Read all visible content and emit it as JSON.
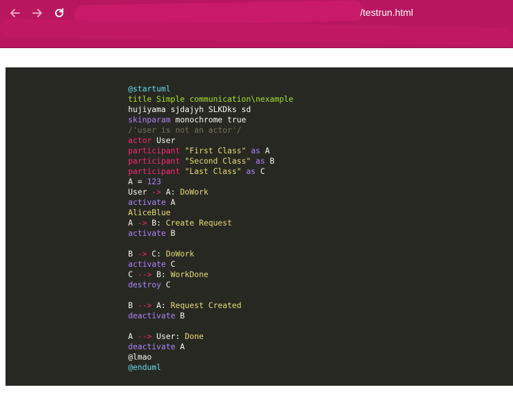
{
  "browser": {
    "url_visible": "/testrun.html",
    "back_icon": "arrow-left-icon",
    "forward_icon": "arrow-right-icon",
    "reload_icon": "reload-icon",
    "accent": "#b8175f"
  },
  "code_panel": {
    "background": "#272822",
    "lines": [
      [
        {
          "t": "@startuml",
          "c": "teal"
        }
      ],
      [
        {
          "t": "title Simple communication\\nexample",
          "c": "grn"
        }
      ],
      [
        {
          "t": "hujiyama sjdajyh SLKDks sd",
          "c": ""
        }
      ],
      [
        {
          "t": "skinparam",
          "c": "kw2"
        },
        {
          "t": " monochrome true",
          "c": ""
        }
      ],
      [
        {
          "t": "/'user is not an actor'/",
          "c": "cm"
        }
      ],
      [
        {
          "t": "actor",
          "c": "kw"
        },
        {
          "t": " User",
          "c": ""
        }
      ],
      [
        {
          "t": "participant",
          "c": "kw"
        },
        {
          "t": " ",
          "c": ""
        },
        {
          "t": "\"First Class\"",
          "c": "str"
        },
        {
          "t": " ",
          "c": ""
        },
        {
          "t": "as",
          "c": "kw2"
        },
        {
          "t": " A",
          "c": ""
        }
      ],
      [
        {
          "t": "participant",
          "c": "kw"
        },
        {
          "t": " ",
          "c": ""
        },
        {
          "t": "\"Second Class\"",
          "c": "str"
        },
        {
          "t": " ",
          "c": ""
        },
        {
          "t": "as",
          "c": "kw2"
        },
        {
          "t": " B",
          "c": ""
        }
      ],
      [
        {
          "t": "participant",
          "c": "kw"
        },
        {
          "t": " ",
          "c": ""
        },
        {
          "t": "\"Last Class\"",
          "c": "str"
        },
        {
          "t": " ",
          "c": ""
        },
        {
          "t": "as",
          "c": "kw2"
        },
        {
          "t": " C",
          "c": ""
        }
      ],
      [
        {
          "t": "A = ",
          "c": ""
        },
        {
          "t": "123",
          "c": "kw2"
        }
      ],
      [
        {
          "t": "User ",
          "c": ""
        },
        {
          "t": "->",
          "c": "kw"
        },
        {
          "t": " A: ",
          "c": ""
        },
        {
          "t": "DoWork",
          "c": "str"
        }
      ],
      [
        {
          "t": "activate",
          "c": "kw2"
        },
        {
          "t": " A",
          "c": ""
        }
      ],
      [
        {
          "t": "AliceBlue",
          "c": "str"
        }
      ],
      [
        {
          "t": "A ",
          "c": ""
        },
        {
          "t": "->",
          "c": "kw"
        },
        {
          "t": " B: ",
          "c": ""
        },
        {
          "t": "Create Request",
          "c": "str"
        }
      ],
      [
        {
          "t": "activate",
          "c": "kw2"
        },
        {
          "t": " B",
          "c": ""
        }
      ],
      [
        {
          "t": "",
          "c": ""
        }
      ],
      [
        {
          "t": "B ",
          "c": ""
        },
        {
          "t": "->",
          "c": "kw"
        },
        {
          "t": " C: ",
          "c": ""
        },
        {
          "t": "DoWork",
          "c": "str"
        }
      ],
      [
        {
          "t": "activate",
          "c": "kw2"
        },
        {
          "t": " C",
          "c": ""
        }
      ],
      [
        {
          "t": "C ",
          "c": ""
        },
        {
          "t": "-->",
          "c": "kw"
        },
        {
          "t": " B: ",
          "c": ""
        },
        {
          "t": "WorkDone",
          "c": "str"
        }
      ],
      [
        {
          "t": "destroy",
          "c": "kw2"
        },
        {
          "t": " C",
          "c": ""
        }
      ],
      [
        {
          "t": "",
          "c": ""
        }
      ],
      [
        {
          "t": "B ",
          "c": ""
        },
        {
          "t": "-->",
          "c": "kw"
        },
        {
          "t": " A: ",
          "c": ""
        },
        {
          "t": "Request Created",
          "c": "str"
        }
      ],
      [
        {
          "t": "deactivate",
          "c": "kw2"
        },
        {
          "t": " B",
          "c": ""
        }
      ],
      [
        {
          "t": "",
          "c": ""
        }
      ],
      [
        {
          "t": "A ",
          "c": ""
        },
        {
          "t": "-->",
          "c": "kw"
        },
        {
          "t": " User: ",
          "c": ""
        },
        {
          "t": "Done",
          "c": "str"
        }
      ],
      [
        {
          "t": "deactivate",
          "c": "kw2"
        },
        {
          "t": " A",
          "c": ""
        }
      ],
      [
        {
          "t": "@lmao",
          "c": ""
        }
      ],
      [
        {
          "t": "@enduml",
          "c": "teal"
        }
      ]
    ]
  }
}
